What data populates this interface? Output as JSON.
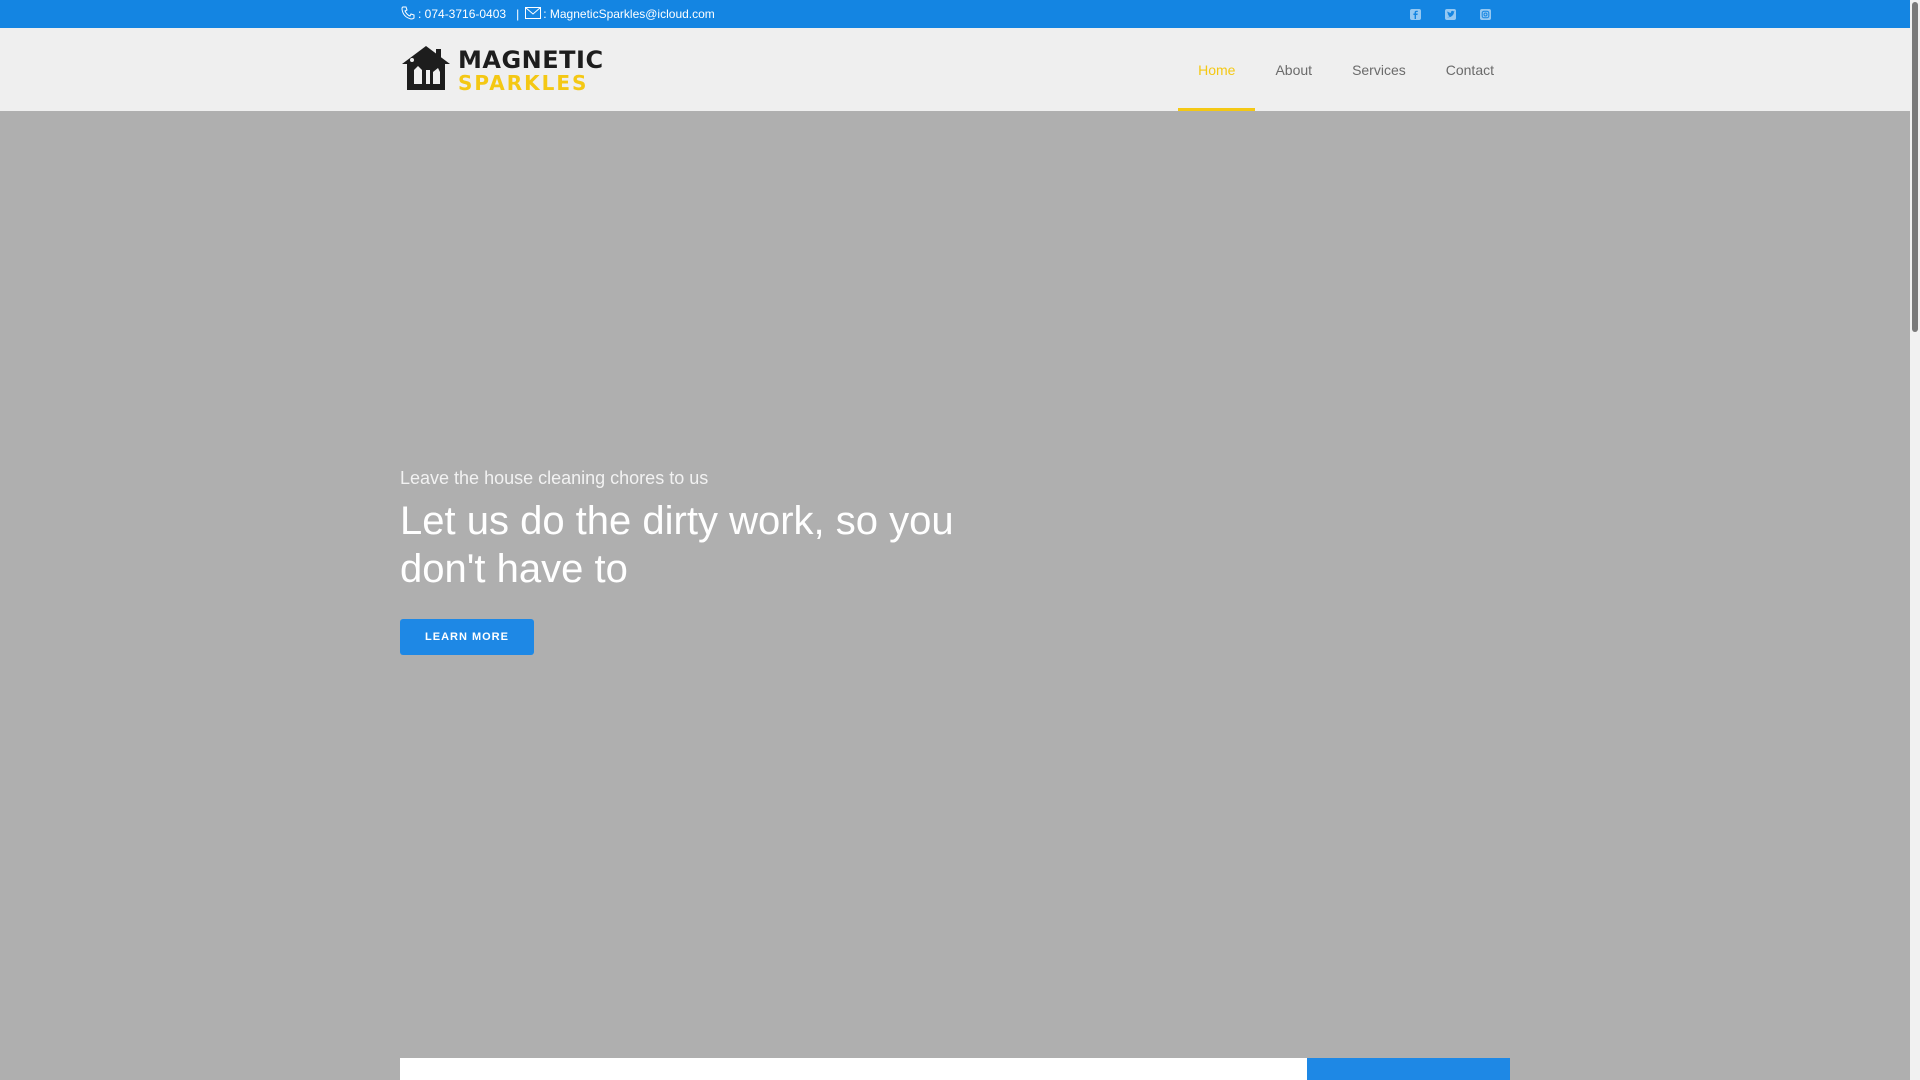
{
  "topbar": {
    "phone_icon": "phone-icon",
    "phone": ": 074-3716-0403",
    "separator": "|",
    "email_icon": "mail-icon",
    "email": ": MagneticSparkles@icloud.com",
    "social": [
      "facebook-icon",
      "twitter-icon",
      "instagram-icon"
    ]
  },
  "logo": {
    "line1": "MAGNETIC",
    "line2": "SPARKLES"
  },
  "nav": {
    "items": [
      {
        "label": "Home",
        "active": true
      },
      {
        "label": "About"
      },
      {
        "label": "Services"
      },
      {
        "label": "Contact"
      }
    ]
  },
  "hero": {
    "subtitle": "Leave the house cleaning chores to us",
    "title": "Let us do the dirty work, so you don't have to",
    "button": "LEARN MORE"
  },
  "colors": {
    "topbar": "#1485e2",
    "accent": "#f4c814",
    "button": "#1e88e5",
    "hero_bg": "#afafaf"
  }
}
